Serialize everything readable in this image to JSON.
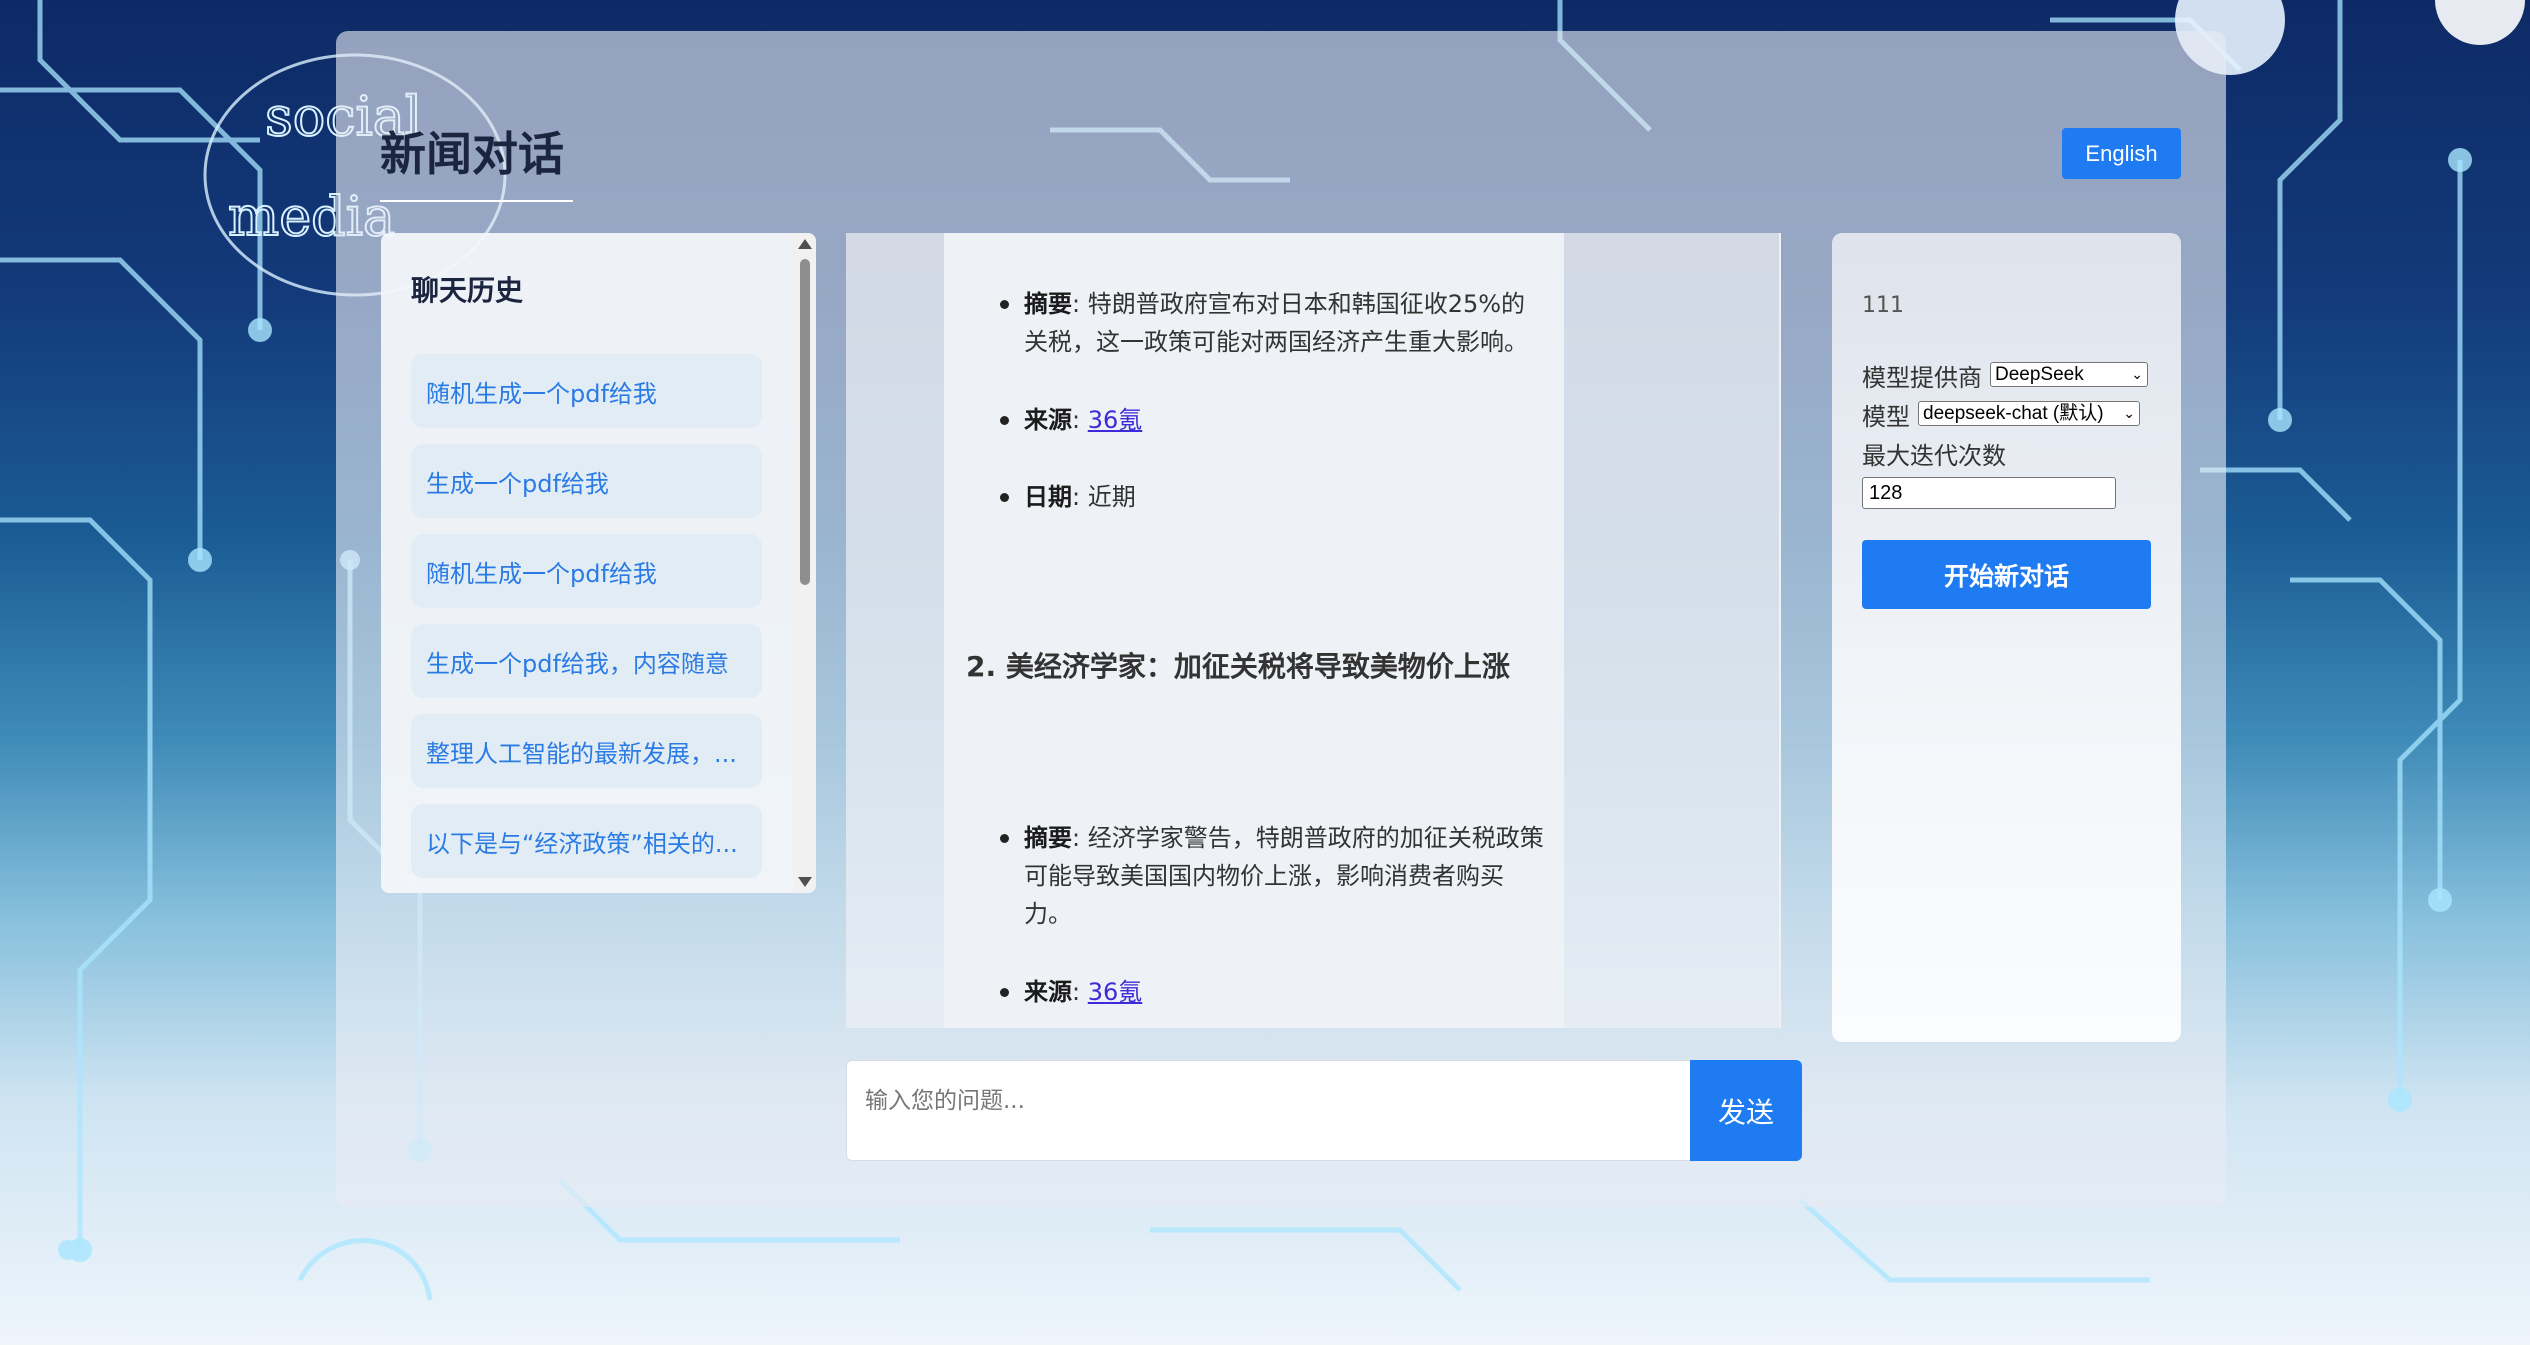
{
  "page": {
    "title": "新闻对话",
    "language_button": "English"
  },
  "history": {
    "title": "聊天历史",
    "items": [
      "随机生成一个pdf给我",
      "生成一个pdf给我",
      "随机生成一个pdf给我",
      "生成一个pdf给我，内容随意",
      "整理人工智能的最新发展，...",
      "以下是与“经济政策”相关的..."
    ]
  },
  "chat": {
    "item1": {
      "summary_label": "摘要",
      "summary_text": ": 特朗普政府宣布对日本和韩国征收25%的关税，这一政策可能对两国经济产生重大影响。",
      "source_label": "来源",
      "source_link": "36氪",
      "date_label": "日期",
      "date_text": ": 近期"
    },
    "section2_title": "2. 美经济学家：加征关税将导致美物价上涨",
    "item2": {
      "summary_label": "摘要",
      "summary_text": ": 经济学家警告，特朗普政府的加征关税政策可能导致美国国内物价上涨，影响消费者购买力。",
      "source_label": "来源",
      "source_link": "36氪"
    }
  },
  "settings": {
    "user_id": "111",
    "provider_label": "模型提供商",
    "provider_value": "DeepSeek",
    "model_label": "模型",
    "model_value": "deepseek-chat (默认)",
    "max_iter_label": "最大迭代次数",
    "max_iter_value": "128",
    "new_chat_button": "开始新对话"
  },
  "input": {
    "placeholder": "输入您的问题...",
    "send_button": "发送"
  }
}
